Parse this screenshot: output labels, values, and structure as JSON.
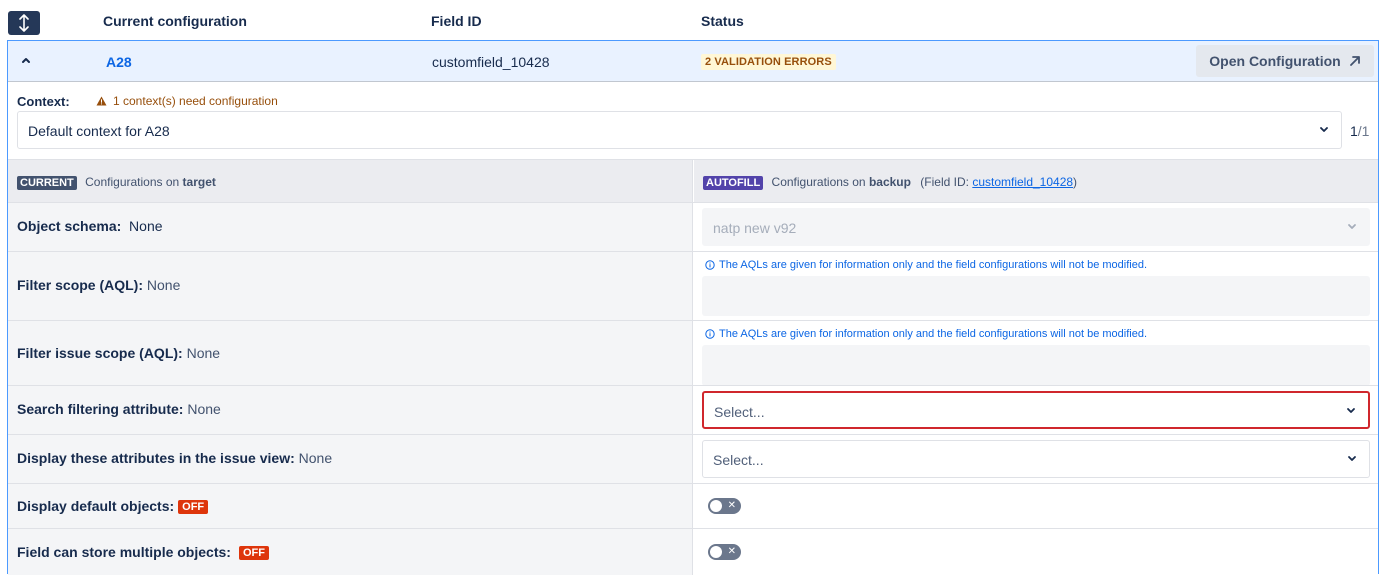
{
  "header": {
    "col_current": "Current configuration",
    "col_field_id": "Field ID",
    "col_status": "Status",
    "expand_icon": "expand-collapse-icon"
  },
  "field": {
    "name": "A28",
    "field_id": "customfield_10428",
    "status": "2 VALIDATION ERRORS",
    "open_button": "Open Configuration"
  },
  "context": {
    "label": "Context:",
    "warning": "1 context(s) need configuration",
    "selected": "Default context for A28",
    "page_current": "1",
    "page_total": "/1"
  },
  "compare_header": {
    "current_lozenge": "CURRENT",
    "current_text_prefix": "Configurations on ",
    "current_target": "target",
    "autofill_lozenge": "AUTOFILL",
    "autofill_text_prefix": "Configurations on ",
    "autofill_target": "backup",
    "field_id_prefix": "(Field ID: ",
    "field_id_link": "customfield_10428",
    "field_id_suffix": ")"
  },
  "rows": {
    "object_schema": {
      "label": "Object schema:",
      "value": "None",
      "select_value": "natp new v92"
    },
    "filter_scope": {
      "label": "Filter scope (AQL):",
      "value": "None",
      "info": "The AQLs are given for information only and the field configurations will not be modified."
    },
    "filter_issue_scope": {
      "label": "Filter issue scope (AQL):",
      "value": "None",
      "info": "The AQLs are given for information only and the field configurations will not be modified."
    },
    "search_filtering": {
      "label": "Search filtering attribute:",
      "value": "None",
      "placeholder": "Select..."
    },
    "display_attributes": {
      "label": "Display these attributes in the issue view:",
      "value": "None",
      "placeholder": "Select..."
    },
    "display_default": {
      "label": "Display default objects:",
      "badge": "OFF",
      "toggle_state": "off"
    },
    "multiple_objects": {
      "label": "Field can store multiple objects:",
      "badge": "OFF",
      "toggle_state": "off"
    }
  },
  "colors": {
    "accent": "#0c66e4",
    "error_border": "#d0272d",
    "off_badge": "#de350b",
    "autofill": "#5243aa",
    "current": "#42526e"
  }
}
